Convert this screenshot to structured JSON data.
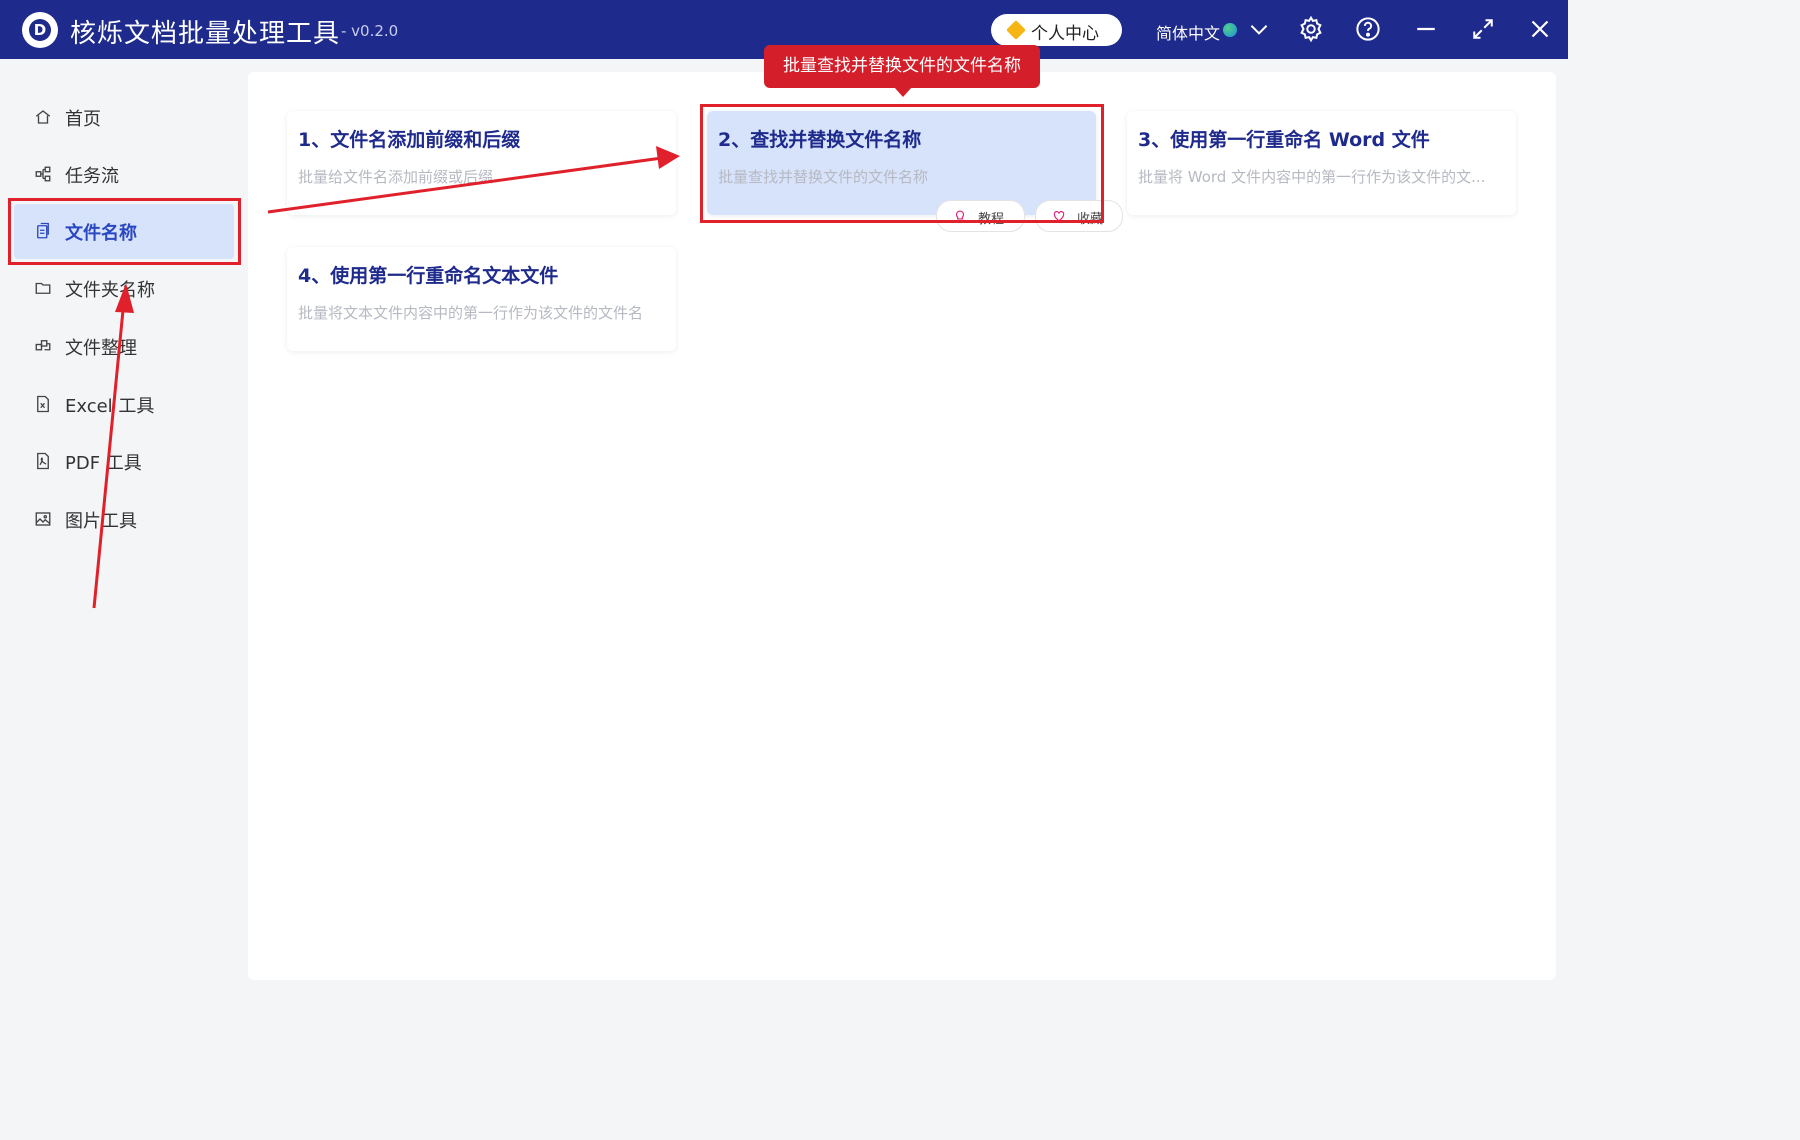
{
  "app": {
    "title": "核烁文档批量处理工具",
    "version": "- v0.2.0",
    "logo_letter": "D",
    "user_center": "个人中心",
    "language": "简体中文"
  },
  "sidebar": {
    "items": [
      {
        "label": "首页",
        "icon": "home-icon"
      },
      {
        "label": "任务流",
        "icon": "workflow-icon"
      },
      {
        "label": "文件名称",
        "icon": "file-copy-icon",
        "active": true
      },
      {
        "label": "文件夹名称",
        "icon": "folder-icon"
      },
      {
        "label": "文件整理",
        "icon": "organize-icon"
      },
      {
        "label": "Excel 工具",
        "icon": "excel-file-icon"
      },
      {
        "label": "PDF 工具",
        "icon": "pdf-file-icon"
      },
      {
        "label": "图片工具",
        "icon": "image-icon"
      }
    ]
  },
  "cards": [
    {
      "title": "1、文件名添加前缀和后缀",
      "desc": "批量给文件名添加前缀或后缀"
    },
    {
      "title": "2、查找并替换文件名称",
      "desc": "批量查找并替换文件的文件名称",
      "highlighted": true
    },
    {
      "title": "3、使用第一行重命名 Word 文件",
      "desc": "批量将 Word 文件内容中的第一行作为该文件的文..."
    },
    {
      "title": "4、使用第一行重命名文本文件",
      "desc": "批量将文本文件内容中的第一行作为该文件的文件名"
    }
  ],
  "card_actions": {
    "tutorial": "教程",
    "favorite": "收藏"
  },
  "annotation": {
    "tooltip": "批量查找并替换文件的文件名称"
  },
  "colors": {
    "titlebar": "#1e2a8c",
    "active_nav_bg": "#d7e3fb",
    "highlight_red": "#e0202a"
  }
}
